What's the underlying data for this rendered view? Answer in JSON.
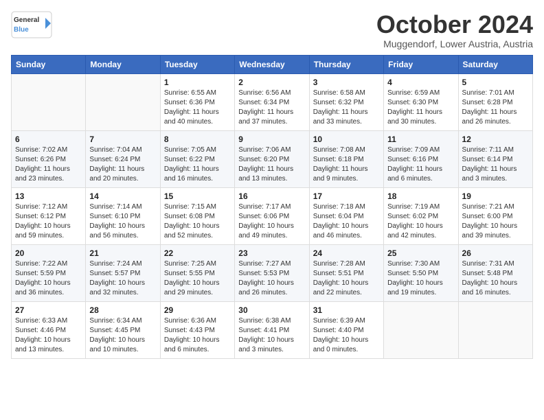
{
  "logo": {
    "line1": "General",
    "line2": "Blue"
  },
  "title": "October 2024",
  "location": "Muggendorf, Lower Austria, Austria",
  "weekdays": [
    "Sunday",
    "Monday",
    "Tuesday",
    "Wednesday",
    "Thursday",
    "Friday",
    "Saturday"
  ],
  "weeks": [
    [
      {
        "day": "",
        "sunrise": "",
        "sunset": "",
        "daylight": ""
      },
      {
        "day": "",
        "sunrise": "",
        "sunset": "",
        "daylight": ""
      },
      {
        "day": "1",
        "sunrise": "Sunrise: 6:55 AM",
        "sunset": "Sunset: 6:36 PM",
        "daylight": "Daylight: 11 hours and 40 minutes."
      },
      {
        "day": "2",
        "sunrise": "Sunrise: 6:56 AM",
        "sunset": "Sunset: 6:34 PM",
        "daylight": "Daylight: 11 hours and 37 minutes."
      },
      {
        "day": "3",
        "sunrise": "Sunrise: 6:58 AM",
        "sunset": "Sunset: 6:32 PM",
        "daylight": "Daylight: 11 hours and 33 minutes."
      },
      {
        "day": "4",
        "sunrise": "Sunrise: 6:59 AM",
        "sunset": "Sunset: 6:30 PM",
        "daylight": "Daylight: 11 hours and 30 minutes."
      },
      {
        "day": "5",
        "sunrise": "Sunrise: 7:01 AM",
        "sunset": "Sunset: 6:28 PM",
        "daylight": "Daylight: 11 hours and 26 minutes."
      }
    ],
    [
      {
        "day": "6",
        "sunrise": "Sunrise: 7:02 AM",
        "sunset": "Sunset: 6:26 PM",
        "daylight": "Daylight: 11 hours and 23 minutes."
      },
      {
        "day": "7",
        "sunrise": "Sunrise: 7:04 AM",
        "sunset": "Sunset: 6:24 PM",
        "daylight": "Daylight: 11 hours and 20 minutes."
      },
      {
        "day": "8",
        "sunrise": "Sunrise: 7:05 AM",
        "sunset": "Sunset: 6:22 PM",
        "daylight": "Daylight: 11 hours and 16 minutes."
      },
      {
        "day": "9",
        "sunrise": "Sunrise: 7:06 AM",
        "sunset": "Sunset: 6:20 PM",
        "daylight": "Daylight: 11 hours and 13 minutes."
      },
      {
        "day": "10",
        "sunrise": "Sunrise: 7:08 AM",
        "sunset": "Sunset: 6:18 PM",
        "daylight": "Daylight: 11 hours and 9 minutes."
      },
      {
        "day": "11",
        "sunrise": "Sunrise: 7:09 AM",
        "sunset": "Sunset: 6:16 PM",
        "daylight": "Daylight: 11 hours and 6 minutes."
      },
      {
        "day": "12",
        "sunrise": "Sunrise: 7:11 AM",
        "sunset": "Sunset: 6:14 PM",
        "daylight": "Daylight: 11 hours and 3 minutes."
      }
    ],
    [
      {
        "day": "13",
        "sunrise": "Sunrise: 7:12 AM",
        "sunset": "Sunset: 6:12 PM",
        "daylight": "Daylight: 10 hours and 59 minutes."
      },
      {
        "day": "14",
        "sunrise": "Sunrise: 7:14 AM",
        "sunset": "Sunset: 6:10 PM",
        "daylight": "Daylight: 10 hours and 56 minutes."
      },
      {
        "day": "15",
        "sunrise": "Sunrise: 7:15 AM",
        "sunset": "Sunset: 6:08 PM",
        "daylight": "Daylight: 10 hours and 52 minutes."
      },
      {
        "day": "16",
        "sunrise": "Sunrise: 7:17 AM",
        "sunset": "Sunset: 6:06 PM",
        "daylight": "Daylight: 10 hours and 49 minutes."
      },
      {
        "day": "17",
        "sunrise": "Sunrise: 7:18 AM",
        "sunset": "Sunset: 6:04 PM",
        "daylight": "Daylight: 10 hours and 46 minutes."
      },
      {
        "day": "18",
        "sunrise": "Sunrise: 7:19 AM",
        "sunset": "Sunset: 6:02 PM",
        "daylight": "Daylight: 10 hours and 42 minutes."
      },
      {
        "day": "19",
        "sunrise": "Sunrise: 7:21 AM",
        "sunset": "Sunset: 6:00 PM",
        "daylight": "Daylight: 10 hours and 39 minutes."
      }
    ],
    [
      {
        "day": "20",
        "sunrise": "Sunrise: 7:22 AM",
        "sunset": "Sunset: 5:59 PM",
        "daylight": "Daylight: 10 hours and 36 minutes."
      },
      {
        "day": "21",
        "sunrise": "Sunrise: 7:24 AM",
        "sunset": "Sunset: 5:57 PM",
        "daylight": "Daylight: 10 hours and 32 minutes."
      },
      {
        "day": "22",
        "sunrise": "Sunrise: 7:25 AM",
        "sunset": "Sunset: 5:55 PM",
        "daylight": "Daylight: 10 hours and 29 minutes."
      },
      {
        "day": "23",
        "sunrise": "Sunrise: 7:27 AM",
        "sunset": "Sunset: 5:53 PM",
        "daylight": "Daylight: 10 hours and 26 minutes."
      },
      {
        "day": "24",
        "sunrise": "Sunrise: 7:28 AM",
        "sunset": "Sunset: 5:51 PM",
        "daylight": "Daylight: 10 hours and 22 minutes."
      },
      {
        "day": "25",
        "sunrise": "Sunrise: 7:30 AM",
        "sunset": "Sunset: 5:50 PM",
        "daylight": "Daylight: 10 hours and 19 minutes."
      },
      {
        "day": "26",
        "sunrise": "Sunrise: 7:31 AM",
        "sunset": "Sunset: 5:48 PM",
        "daylight": "Daylight: 10 hours and 16 minutes."
      }
    ],
    [
      {
        "day": "27",
        "sunrise": "Sunrise: 6:33 AM",
        "sunset": "Sunset: 4:46 PM",
        "daylight": "Daylight: 10 hours and 13 minutes."
      },
      {
        "day": "28",
        "sunrise": "Sunrise: 6:34 AM",
        "sunset": "Sunset: 4:45 PM",
        "daylight": "Daylight: 10 hours and 10 minutes."
      },
      {
        "day": "29",
        "sunrise": "Sunrise: 6:36 AM",
        "sunset": "Sunset: 4:43 PM",
        "daylight": "Daylight: 10 hours and 6 minutes."
      },
      {
        "day": "30",
        "sunrise": "Sunrise: 6:38 AM",
        "sunset": "Sunset: 4:41 PM",
        "daylight": "Daylight: 10 hours and 3 minutes."
      },
      {
        "day": "31",
        "sunrise": "Sunrise: 6:39 AM",
        "sunset": "Sunset: 4:40 PM",
        "daylight": "Daylight: 10 hours and 0 minutes."
      },
      {
        "day": "",
        "sunrise": "",
        "sunset": "",
        "daylight": ""
      },
      {
        "day": "",
        "sunrise": "",
        "sunset": "",
        "daylight": ""
      }
    ]
  ]
}
